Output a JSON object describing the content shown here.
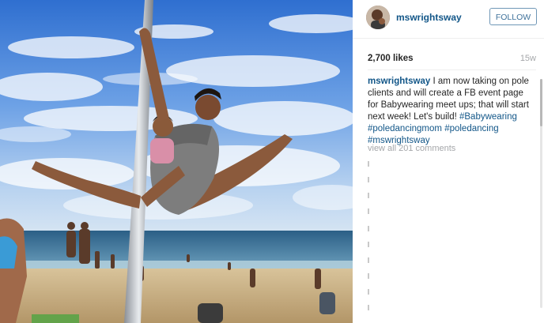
{
  "post": {
    "username": "mswrightsway",
    "follow_label": "FOLLOW",
    "likes": "2,700 likes",
    "age": "15w",
    "caption_user": "mswrightsway",
    "caption_text": " I am now taking on pole clients and will create a FB event page for Babywearing meet ups; that will start next week! Let's build! ",
    "hashtags": [
      "#Babywearing",
      "#poledancingmom",
      "#poledancing",
      "#mswrightsway"
    ],
    "view_all": "view all 201 comments"
  },
  "icons": {
    "avatar": "profile-photo",
    "photo": "beach-pole-photo"
  },
  "colors": {
    "link": "#125688",
    "follow": "#3f729b",
    "muted": "#a5a7aa"
  }
}
